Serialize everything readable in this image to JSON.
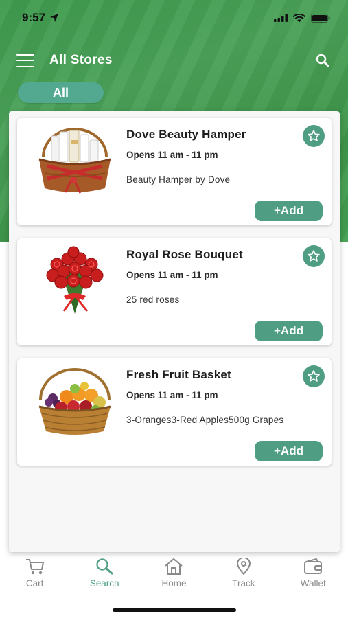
{
  "status_bar": {
    "time": "9:57"
  },
  "header": {
    "title": "All Stores"
  },
  "filter": {
    "chip_label": "All"
  },
  "products": [
    {
      "title": "Dove Beauty Hamper",
      "hours": "Opens 11 am - 11 pm",
      "description": "Beauty Hamper by Dove",
      "add_label": "+Add",
      "image": "gift-basket-image"
    },
    {
      "title": "Royal Rose Bouquet",
      "hours": "Opens 11 am - 11 pm",
      "description": "25 red roses",
      "add_label": "+Add",
      "image": "rose-bouquet-image"
    },
    {
      "title": "Fresh Fruit Basket",
      "hours": "Opens 11 am - 11 pm",
      "description": "3-Oranges3-Red Apples500g Grapes",
      "add_label": "+Add",
      "image": "fruit-basket-image"
    }
  ],
  "tabbar": {
    "items": [
      {
        "label": "Cart",
        "icon": "cart-icon"
      },
      {
        "label": "Search",
        "icon": "search-icon",
        "active": true
      },
      {
        "label": "Home",
        "icon": "home-icon"
      },
      {
        "label": "Track",
        "icon": "location-pin-icon"
      },
      {
        "label": "Wallet",
        "icon": "wallet-icon"
      }
    ]
  },
  "colors": {
    "brand_green": "#44a052",
    "accent_teal": "#4f9e84",
    "inactive_gray": "#8a8a8a"
  }
}
